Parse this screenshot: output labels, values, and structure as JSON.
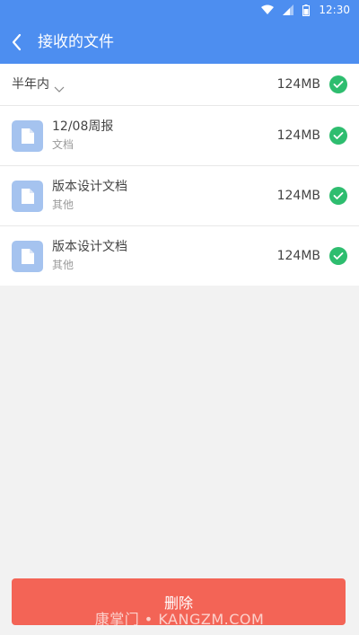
{
  "status_bar": {
    "time": "12:30",
    "icons": [
      "wifi-icon",
      "signal-icon",
      "battery-icon"
    ]
  },
  "nav": {
    "back_icon": "chevron-left-icon",
    "title": "接收的文件"
  },
  "filter": {
    "label": "半年内",
    "total_size": "124MB",
    "all_selected": true
  },
  "files": [
    {
      "name": "12/08周报",
      "type": "文档",
      "size": "124MB",
      "selected": true
    },
    {
      "name": "版本设计文档",
      "type": "其他",
      "size": "124MB",
      "selected": true
    },
    {
      "name": "版本设计文档",
      "type": "其他",
      "size": "124MB",
      "selected": true
    }
  ],
  "actions": {
    "delete_label": "删除"
  },
  "watermark": "康掌门 • KANGZM.COM",
  "colors": {
    "primary": "#4d8ef0",
    "check": "#2ebd6f",
    "delete": "#f36456",
    "file_icon": "#a5c3ef"
  }
}
